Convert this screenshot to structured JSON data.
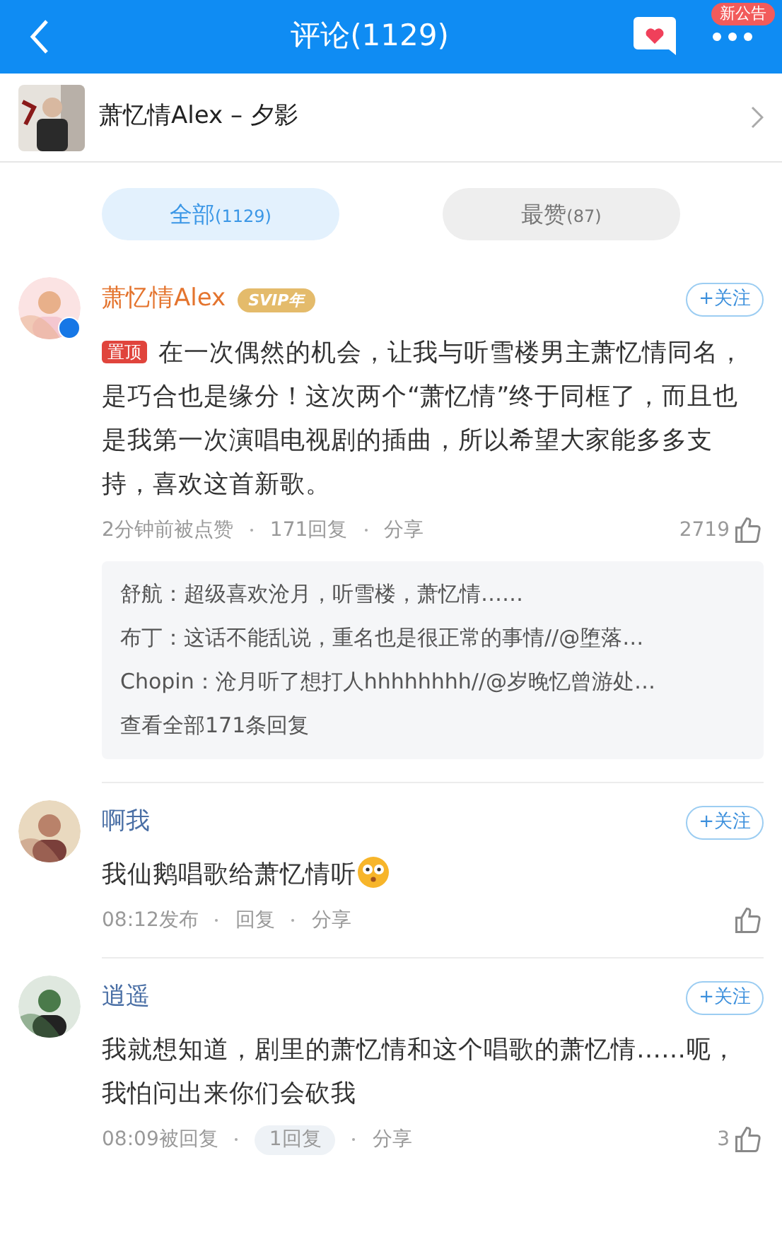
{
  "header": {
    "title": "评论(1129)",
    "badge": "新公告"
  },
  "song": {
    "title": "萧忆情Alex – 夕影"
  },
  "tabs": [
    {
      "label": "全部",
      "count": "(1129)",
      "selected": true
    },
    {
      "label": "最赞",
      "count": "(87)",
      "selected": false
    }
  ],
  "comments": [
    {
      "user": "萧忆情Alex",
      "vip": "SVIP年",
      "verified": true,
      "follow": "+关注",
      "pinned": "置顶",
      "text": "在一次偶然的机会，让我与听雪楼男主萧忆情同名，是巧合也是缘分！这次两个“萧忆情”终于同框了，而且也是我第一次演唱电视剧的插曲，所以希望大家能多多支持，喜欢这首新歌。",
      "time": "2分钟前被点赞",
      "reply": "171回复",
      "reply_highlight": false,
      "share": "分享",
      "likes": "2719",
      "replies": [
        {
          "text": "舒航：超级喜欢沧月，听雪楼，萧忆情……"
        },
        {
          "text": "布丁：这话不能乱说，重名也是很正常的事情//@堕落…"
        },
        {
          "text": "Chopin：沧月听了想打人hhhhhhhh//@岁晚忆曾游处…"
        }
      ],
      "more": "查看全部171条回复"
    },
    {
      "user": "啊我",
      "follow": "+关注",
      "text": "我仙鹅唱歌给萧忆情听",
      "emoji": true,
      "time": "08:12发布",
      "reply": "回复",
      "reply_highlight": false,
      "share": "分享"
    },
    {
      "user": "逍遥",
      "follow": "+关注",
      "text": "我就想知道，剧里的萧忆情和这个唱歌的萧忆情……呃，我怕问出来你们会砍我",
      "time": "08:09被回复",
      "reply": "1回复",
      "reply_highlight": true,
      "share": "分享",
      "likes": "3"
    }
  ]
}
